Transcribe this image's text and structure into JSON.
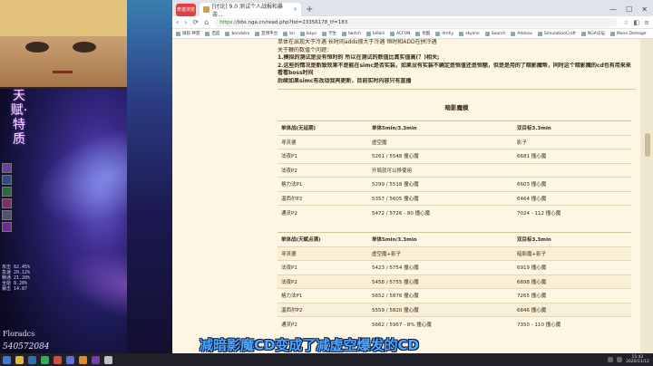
{
  "stream": {
    "vertical_text": "天赋·特质",
    "streamer_name": "Floradcs",
    "user_id": "540572084",
    "stats": [
      "攻击 82.45%",
      "急速 20.12%",
      "精通 21.20%",
      "全能 8.20%",
      "暴击 14.87"
    ],
    "subtitle": "减暗影魔CD变成了减虚空爆发的CD"
  },
  "browser": {
    "brand": "奇迹浏览器",
    "tab_title": "[讨论] 9.0 测试个人战报和暴击...",
    "tab_close": "×",
    "new_tab": "+",
    "window_controls": [
      "—",
      "☐",
      "✕"
    ],
    "nav": [
      "‹",
      "›",
      "⟳",
      "⌂"
    ],
    "url_secure": "https://",
    "url_rest": "bbs.nga.cn/read.php?tid=23356178_tf=183",
    "bookmarks": [
      "微软·神游",
      "百度",
      "bondstrx",
      "亚博平台",
      "bn",
      "bayo",
      "学生",
      "twitch",
      "bilibili",
      "ACFUN",
      "优酷",
      "dmhy",
      "skyline",
      "Search",
      "Addons",
      "SimulationCraft",
      "NGA论坛",
      "Mono Damage"
    ]
  },
  "post": {
    "intro": [
      "单体在出现大于冷遇 长时间adds很大于冷遇 恒时和ADD在拼冷遇",
      "关于鞭的数值个问题：",
      "1.模拟的测试是没有恒时的 所以在测试的数值比真实值高(？)相关;",
      "2.这些的情况是新致效果不是能在simc是否实装，如果没有实装不确定是恒值还是恒额，但是是用的了暗影魔帮，同时这个暗影魔的cd也有用来来看看boss时间",
      "后续如果simc有改动我再更新，目前实时内容只有直播"
    ],
    "section_title": "暗影魔模"
  },
  "table1": {
    "header": [
      "单体战(无延期)",
      "单体5min/3.3min",
      "双目标3.3min"
    ],
    "rows": [
      [
        "寻灵德",
        "虚空魔",
        "影子"
      ],
      [
        "法夜P1",
        "5261 / 5548 撞心魔",
        "6681 撞心魔"
      ],
      [
        "法夜P2",
        "开局就可以移使用",
        ""
      ],
      [
        "格力法P1",
        "5299 / 5518 撞心魔",
        "6603 撞心魔"
      ],
      [
        "温西尔P2",
        "5357 / 5605 撞心魔",
        "6464 撞心魔"
      ],
      [
        "通灵P2",
        "5472 / 5726 - 80 撞心魔",
        "7024 - 112 撞心魔"
      ]
    ]
  },
  "table2": {
    "header": [
      "单体战(天赋点满)",
      "单体5min/3.3min",
      "双目标3.3min"
    ],
    "rows": [
      [
        "寻灵德",
        "虚空魔+影子",
        "暗影魔+影子"
      ],
      [
        "法夜P1",
        "5423 / 5754 撞心魔",
        "6919 撞心魔"
      ],
      [
        "法夜P2",
        "5458 / 5755 撞心魔",
        "6898 撞心魔"
      ],
      [
        "格力法P1",
        "5652 / 5876 撞心魔",
        "7265 撞心魔"
      ],
      [
        "温西尔P2",
        "5559 / 5820 撞心魔",
        "6846 撞心魔"
      ],
      [
        "通灵P2",
        "5662 / 5967 - 8% 撞心魔",
        "7350 - 110 撞心魔"
      ]
    ]
  },
  "taskbar": {
    "time": "15:42",
    "date": "2020/11/12"
  }
}
